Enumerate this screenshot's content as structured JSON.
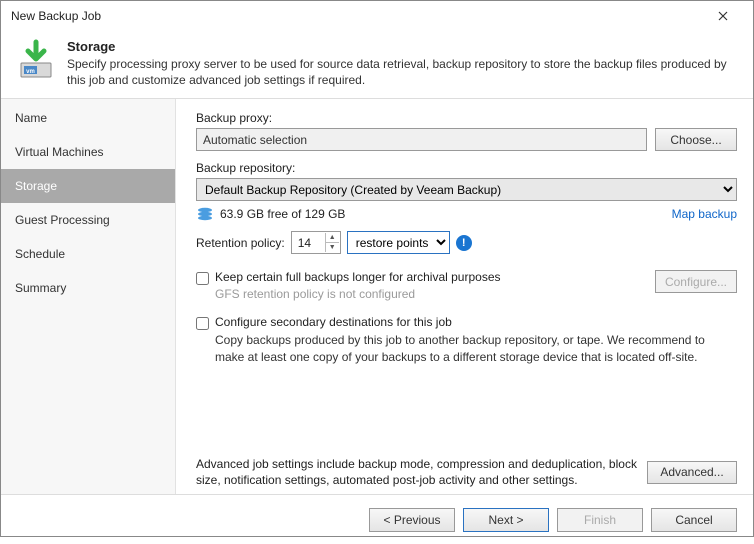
{
  "window": {
    "title": "New Backup Job"
  },
  "header": {
    "title": "Storage",
    "subtitle": "Specify processing proxy server to be used for source data retrieval, backup repository to store the backup files produced by this job and customize advanced job settings if required."
  },
  "sidebar": {
    "steps": [
      {
        "label": "Name"
      },
      {
        "label": "Virtual Machines"
      },
      {
        "label": "Storage",
        "active": true
      },
      {
        "label": "Guest Processing"
      },
      {
        "label": "Schedule"
      },
      {
        "label": "Summary"
      }
    ]
  },
  "content": {
    "proxy_label": "Backup proxy:",
    "proxy_value": "Automatic selection",
    "choose_label": "Choose...",
    "repo_label": "Backup repository:",
    "repo_value": "Default Backup Repository (Created by Veeam Backup)",
    "freespace": "63.9 GB free of 129 GB",
    "map_label": "Map backup",
    "retention_label": "Retention policy:",
    "retention_value": "14",
    "retention_unit": "restore points",
    "keep_full": {
      "label": "Keep certain full backups longer for archival purposes",
      "sub": "GFS retention policy is not configured",
      "configure": "Configure..."
    },
    "secondary": {
      "label": "Configure secondary destinations for this job",
      "desc": "Copy backups produced by this job to another backup repository, or tape. We recommend to make at least one copy of your backups to a different storage device that is located off-site."
    },
    "advanced_text": "Advanced job settings include backup mode, compression and deduplication, block size, notification settings, automated post-job activity and other settings.",
    "advanced_btn": "Advanced..."
  },
  "footer": {
    "previous": "< Previous",
    "next": "Next >",
    "finish": "Finish",
    "cancel": "Cancel"
  }
}
